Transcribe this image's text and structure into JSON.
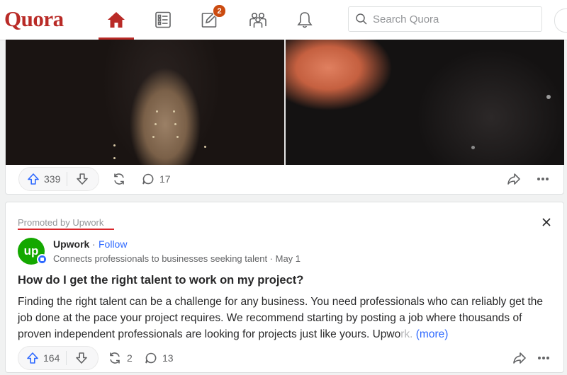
{
  "header": {
    "logo": "Quora",
    "nav": [
      {
        "name": "home",
        "active": true
      },
      {
        "name": "following"
      },
      {
        "name": "answer",
        "badge": "2"
      },
      {
        "name": "spaces"
      },
      {
        "name": "notifications"
      }
    ],
    "search_placeholder": "Search Quora"
  },
  "post1": {
    "upvotes": "339",
    "comments": "17"
  },
  "post2": {
    "promoted": "Promoted by Upwork",
    "avatar_text": "up",
    "author": "Upwork",
    "separator": "·",
    "follow": "Follow",
    "tagline": "Connects professionals to businesses seeking talent · May 1",
    "question": "How do I get the right talent to work on my project?",
    "body_main": "Finding the right talent can be a challenge for any business. You need professionals who can reliably get the job done at the pace your project requires. We recommend starting by posting a job where thousands of proven independent professionals are looking for projects just like yours. Upwo",
    "body_fade": "rk.",
    "more": "(more)",
    "upvotes": "164",
    "shares": "2",
    "comments": "13"
  },
  "colors": {
    "brand": "#b92b27",
    "link": "#2e69ff",
    "upwork_green": "#14a800",
    "badge": "#cb4b10"
  }
}
